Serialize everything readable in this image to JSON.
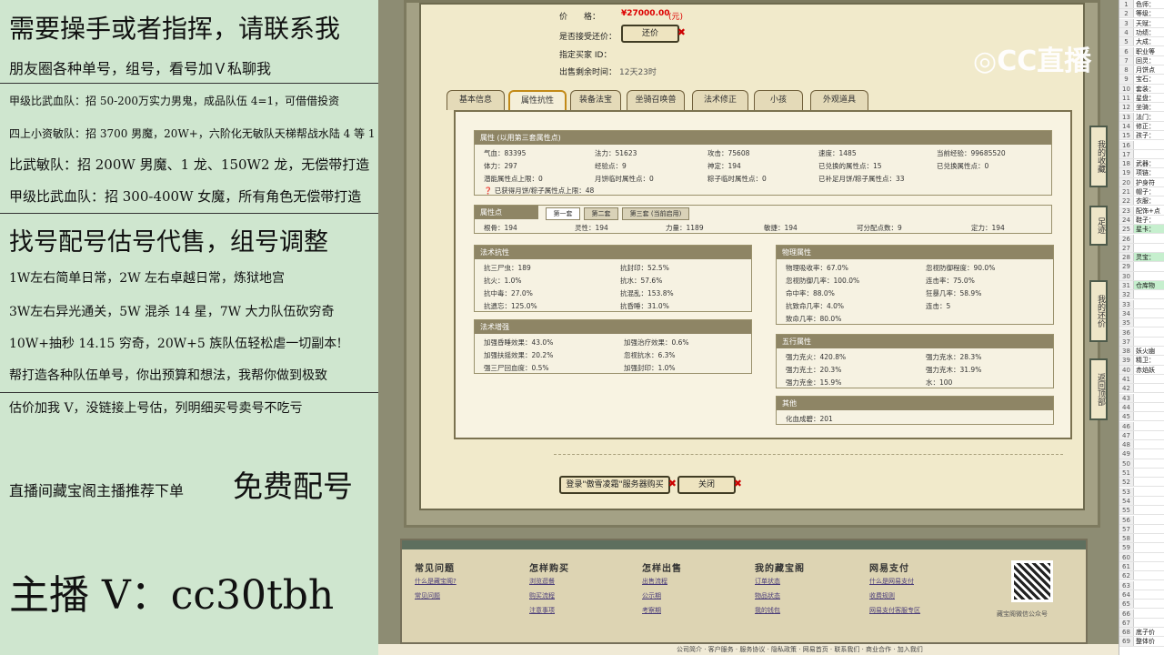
{
  "promo": {
    "l1": "需要操手或者指挥，请联系我",
    "l2": "朋友圈各种单号，组号，看号加Ｖ私聊我",
    "l3": "甲级比武血队：招 50-200万实力男鬼，成品队伍 4=1，可借借投资",
    "l4": "四上小资敏队：招 3700 男魔，20W+，六阶化无敏队天梯帮战水陆 4 等 1",
    "l5": "比武敏队：招 200W 男魔、1 龙、150W2 龙，无偿带打造",
    "l6": "甲级比武血队：招 300-400W 女魔，所有角色无偿带打造",
    "l7": "找号配号估号代售，组号调整",
    "l8": "1W左右简单日常，2W 左右卓越日常，炼狱地宫",
    "l9": "3W左右异光通关，5W 混杀 14 星，7W 大力队伍砍穷奇",
    "l10": "10W+抽秒 14.15 穷奇，20W+5 族队伍轻松虐一切副本!",
    "l11": "帮打造各种队伍单号，你出预算和想法，我帮你做到极致",
    "l12": "估价加我 V，没链接上号估，列明细买号卖号不吃亏",
    "l13a": "直播间藏宝阁主播推荐下单",
    "l13b": "免费配号",
    "l14": "主播 V：cc30tbh"
  },
  "top": {
    "price_label": "价　　格：",
    "price_value": "¥27000.00",
    "price_unit": "(元)",
    "bargain_label": "是否接受还价：",
    "bargain_btn": "还价",
    "buyer_label": "指定买家 ID：",
    "time_label": "出售剩余时间：",
    "time_value": "12天23时"
  },
  "tabs": [
    "基本信息",
    "属性抗性",
    "装备法宝",
    "坐骑召唤兽",
    "法术修正",
    "小孩",
    "外观道具"
  ],
  "attr": {
    "title": "属性 (以用第三套属性点)",
    "rows": [
      [
        "气血：83395",
        "法力：51623",
        "攻击：75608",
        "速度：1485",
        "当前经验：99685520"
      ],
      [
        "体力：297",
        "经验点：9",
        "神定：194",
        "已兑换的属性点：15",
        "已兑换属性点：0"
      ],
      [
        "潜能属性点上限：0",
        "月饼临时属性点：0",
        "粽子临时属性点：0",
        "已补足月饼/粽子属性点：33",
        ""
      ]
    ],
    "note": "已获得月饼/粽子属性点上限：48"
  },
  "points": {
    "title": "属性点",
    "subtabs": [
      "第一套",
      "第二套",
      "第三套 (当前启用)"
    ],
    "row": [
      "根骨：194",
      "灵性：194",
      "力量：1189",
      "敏捷：194",
      "可分配点数：9",
      "定力：194"
    ]
  },
  "spell_res": {
    "title": "法术抗性",
    "cells": [
      "抗三尸虫：189",
      "抗封印：52.5%",
      "抗火：1.0%",
      "抗水：57.6%",
      "抗中毒：27.0%",
      "抗混乱：153.8%",
      "抗遗忘：125.0%",
      "抗昏睡：31.0%"
    ]
  },
  "spell_boost": {
    "title": "法术增强",
    "cells": [
      "加强昏睡效果：43.0%",
      "加强治疗效果：0.6%",
      "加强扶摇效果：20.2%",
      "忽视抗水：6.3%",
      "强三尸回血度：0.5%",
      "加强封印：1.0%"
    ]
  },
  "physical": {
    "title": "物理属性",
    "cells": [
      "物理吸收率：67.0%",
      "忽视防御程度：90.0%",
      "忽视防御几率：100.0%",
      "连击率：75.0%",
      "命中率：88.0%",
      "狂暴几率：58.9%",
      "抗致命几率：4.0%",
      "连击：5",
      "致命几率：80.0%",
      ""
    ]
  },
  "five": {
    "title": "五行属性",
    "cells": [
      "强力克火：420.8%",
      "强力克水：28.3%",
      "强力克土：20.3%",
      "强力克木：31.9%",
      "强力克金：15.9%",
      "水：100"
    ]
  },
  "other": {
    "title": "其他",
    "cell": "化血成碧：201"
  },
  "actions": {
    "login": "登录\"傲雪凌霜\"服务器购买",
    "close": "关闭"
  },
  "footer": {
    "cols": [
      {
        "h": "常见问题",
        "links": [
          "什么是藏宝阁?",
          "常见问题"
        ]
      },
      {
        "h": "怎样购买",
        "links": [
          "浏览逛餐",
          "购买流程",
          "注意事项"
        ]
      },
      {
        "h": "怎样出售",
        "links": [
          "出售流程",
          "公示期",
          "考察期"
        ]
      },
      {
        "h": "我的藏宝阁",
        "links": [
          "订单状态",
          "物品状态",
          "我的钱包"
        ]
      },
      {
        "h": "网易支付",
        "links": [
          "什么是网易支付",
          "收费规则",
          "网易支付客服专区"
        ]
      }
    ],
    "qr_caption": "藏宝阁微信公众号",
    "bottom": "公司简介 · 客户服务 · 服务协议 · 隐私政策 · 网易首页 · 联系我们 · 商业合作 · 加入我们"
  },
  "side": [
    "我的收藏",
    "足迹",
    "我的还价",
    "返回顶部"
  ],
  "logo": "CC直播",
  "sheet": [
    [
      "1",
      "色师："
    ],
    [
      "2",
      "等级："
    ],
    [
      "3",
      "天赋："
    ],
    [
      "4",
      "功绩："
    ],
    [
      "5",
      "大成："
    ],
    [
      "6",
      "职业等"
    ],
    [
      "7",
      "回灵："
    ],
    [
      "8",
      "月饼点"
    ],
    [
      "9",
      "宝石："
    ],
    [
      "10",
      "套装："
    ],
    [
      "11",
      "星盘："
    ],
    [
      "12",
      "坐骑："
    ],
    [
      "13",
      "法门："
    ],
    [
      "14",
      "修正："
    ],
    [
      "15",
      "孩子："
    ],
    [
      "16",
      ""
    ],
    [
      "17",
      ""
    ],
    [
      "18",
      "武器："
    ],
    [
      "19",
      "项链："
    ],
    [
      "20",
      "护身符"
    ],
    [
      "21",
      "帽子："
    ],
    [
      "22",
      "衣服："
    ],
    [
      "23",
      "配饰+点"
    ],
    [
      "24",
      "鞋子："
    ],
    [
      "25",
      "星卡："
    ],
    [
      "26",
      ""
    ],
    [
      "27",
      ""
    ],
    [
      "28",
      "灵宝："
    ],
    [
      "29",
      ""
    ],
    [
      "30",
      ""
    ],
    [
      "31",
      "仓库物"
    ],
    [
      "32",
      ""
    ],
    [
      "33",
      ""
    ],
    [
      "34",
      ""
    ],
    [
      "35",
      ""
    ],
    [
      "36",
      ""
    ],
    [
      "37",
      ""
    ],
    [
      "38",
      "妖火幽"
    ],
    [
      "39",
      "精卫："
    ],
    [
      "40",
      "赤焰妖"
    ],
    [
      "41",
      ""
    ],
    [
      "42",
      ""
    ],
    [
      "43",
      ""
    ],
    [
      "44",
      ""
    ],
    [
      "45",
      ""
    ],
    [
      "46",
      ""
    ],
    [
      "47",
      ""
    ],
    [
      "48",
      ""
    ],
    [
      "49",
      ""
    ],
    [
      "50",
      ""
    ],
    [
      "51",
      ""
    ],
    [
      "52",
      ""
    ],
    [
      "53",
      ""
    ],
    [
      "54",
      ""
    ],
    [
      "55",
      ""
    ],
    [
      "56",
      ""
    ],
    [
      "57",
      ""
    ],
    [
      "58",
      ""
    ],
    [
      "59",
      ""
    ],
    [
      "60",
      ""
    ],
    [
      "61",
      ""
    ],
    [
      "62",
      ""
    ],
    [
      "63",
      ""
    ],
    [
      "64",
      ""
    ],
    [
      "65",
      ""
    ],
    [
      "66",
      ""
    ],
    [
      "67",
      ""
    ],
    [
      "68",
      "底子价"
    ],
    [
      "69",
      "整体价"
    ]
  ]
}
